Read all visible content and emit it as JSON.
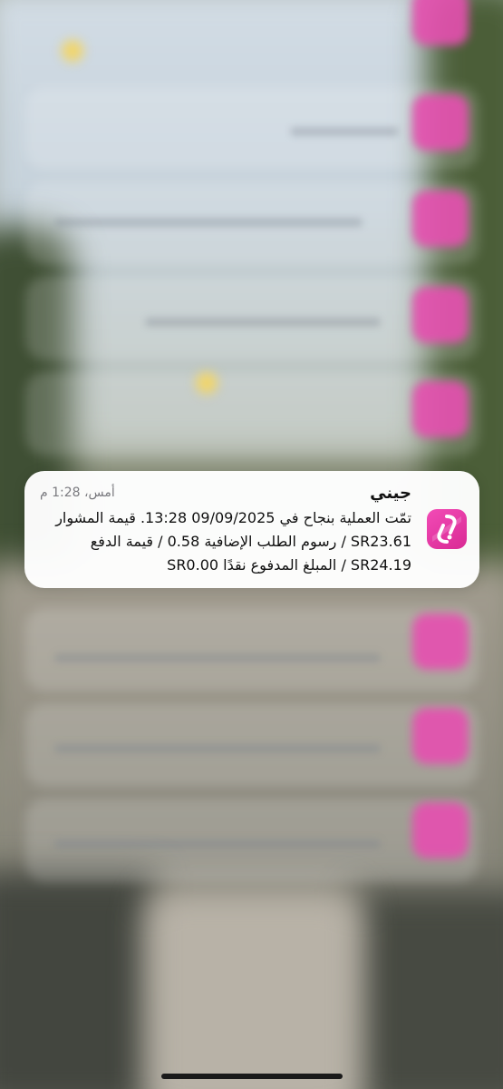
{
  "notification": {
    "app_name": "جيني",
    "time": "أمس، 1:28 م",
    "body_lines": [
      "تمّت العملية بنجاح في 09/09/2025 13:28. قيمة المشوار",
      "SR23.61 / رسوم الطلب الإضافية 0.58 / قيمة الدفع",
      "SR24.19 / المبلغ المدفوع نقدًا SR0.00"
    ],
    "icon": "jeeny-app-icon",
    "accent_color": "#E93FAB"
  }
}
